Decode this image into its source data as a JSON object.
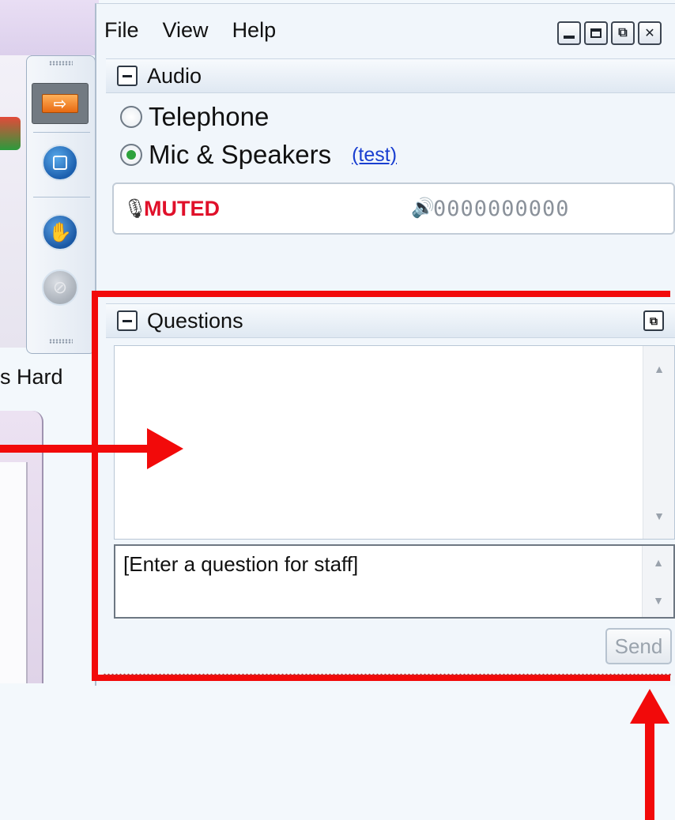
{
  "background": {
    "partial_label": "s Hard"
  },
  "menu": {
    "file": "File",
    "view": "View",
    "help": "Help"
  },
  "audio": {
    "title": "Audio",
    "options": {
      "telephone": "Telephone",
      "mic_speakers": "Mic & Speakers"
    },
    "selected": "Mic & Speakers",
    "test_link": "(test)",
    "status": "MUTED",
    "level_meter": "0000000000"
  },
  "questions": {
    "title": "Questions",
    "input_placeholder": "[Enter a question for staff]",
    "send_label": "Send"
  },
  "colors": {
    "annotation_red": "#f20a0a",
    "muted_red": "#e0102a",
    "link_blue": "#1a3fd0",
    "selected_radio_green": "#2ea23c"
  }
}
